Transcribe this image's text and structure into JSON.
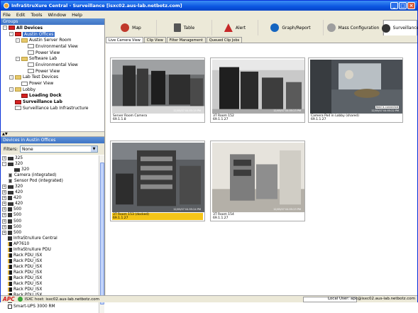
{
  "window": {
    "title": "InfraStruXure Central - Surveillance [isxc02.aus-lab.netbotz.com]",
    "controls": [
      "_",
      "□",
      "×"
    ]
  },
  "menu": [
    "File",
    "Edit",
    "Tools",
    "Window",
    "Help"
  ],
  "groups": {
    "header": "Groups",
    "tree": [
      {
        "label": "All Devices",
        "level": 0,
        "exp": "-",
        "icon": "red",
        "bold": true
      },
      {
        "label": "Austin Offices",
        "level": 1,
        "exp": "-",
        "icon": "red",
        "selected": true
      },
      {
        "label": "Austin Server Room",
        "level": 2,
        "exp": "-",
        "icon": "folder"
      },
      {
        "label": "Environmental View",
        "level": 3,
        "icon": "plain"
      },
      {
        "label": "Power View",
        "level": 3,
        "icon": "plain"
      },
      {
        "label": "Software Lab",
        "level": 2,
        "exp": "-",
        "icon": "folder"
      },
      {
        "label": "Environmental View",
        "level": 3,
        "icon": "plain"
      },
      {
        "label": "Power View",
        "level": 3,
        "icon": "plain"
      },
      {
        "label": "Lab Test Devices",
        "level": 1,
        "exp": "-",
        "icon": "folder"
      },
      {
        "label": "Power View",
        "level": 2,
        "icon": "plain"
      },
      {
        "label": "Lobby",
        "level": 1,
        "exp": "-",
        "icon": "folder"
      },
      {
        "label": "Loading Dock",
        "level": 2,
        "icon": "red",
        "bold": true
      },
      {
        "label": "Surveillance Lab",
        "level": 1,
        "icon": "red",
        "bold": true
      },
      {
        "label": "Surveillance Lab Infrastructure",
        "level": 1,
        "icon": "plain"
      }
    ]
  },
  "devices": {
    "header": "Devices in Austin Offices",
    "filter_label": "Filters:",
    "filter_value": "None",
    "items": [
      {
        "label": "325",
        "level": 0,
        "exp": "+",
        "icon": "dev"
      },
      {
        "label": "320",
        "level": 0,
        "exp": "-",
        "icon": "dev"
      },
      {
        "label": "320",
        "level": 1,
        "icon": "dev"
      },
      {
        "label": "Camera (integrated)",
        "level": 1,
        "icon": "cam"
      },
      {
        "label": "Sensor Pod (integrated)",
        "level": 1,
        "icon": "cam"
      },
      {
        "label": "320",
        "level": 0,
        "exp": "+",
        "icon": "dev"
      },
      {
        "label": "420",
        "level": 0,
        "exp": "+",
        "icon": "dev"
      },
      {
        "label": "420",
        "level": 0,
        "exp": "+",
        "icon": "box"
      },
      {
        "label": "420",
        "level": 0,
        "exp": "+",
        "icon": "dev"
      },
      {
        "label": "500",
        "level": 0,
        "exp": "+",
        "icon": "box"
      },
      {
        "label": "500",
        "level": 0,
        "exp": "+",
        "icon": "box"
      },
      {
        "label": "500",
        "level": 0,
        "exp": "+",
        "icon": "box"
      },
      {
        "label": "500",
        "level": 0,
        "exp": "+",
        "icon": "box"
      },
      {
        "label": "500",
        "level": 0,
        "exp": "+",
        "icon": "box"
      },
      {
        "label": "InfraStruXure Central",
        "level": 0,
        "icon": "box"
      },
      {
        "label": "AP7610",
        "level": 0,
        "icon": "pdu"
      },
      {
        "label": "InfraStruXure PDU",
        "level": 0,
        "icon": "pdu"
      },
      {
        "label": "Rack PDU_ISX",
        "level": 0,
        "icon": "pdu"
      },
      {
        "label": "Rack PDU_ISX",
        "level": 0,
        "icon": "pdu"
      },
      {
        "label": "Rack PDU_ISX",
        "level": 0,
        "icon": "pdu"
      },
      {
        "label": "Rack PDU_ISX",
        "level": 0,
        "icon": "pdu"
      },
      {
        "label": "Rack PDU_ISX",
        "level": 0,
        "icon": "pdu"
      },
      {
        "label": "Rack PDU_ISX",
        "level": 0,
        "icon": "pdu"
      },
      {
        "label": "Rack PDU_ISX",
        "level": 0,
        "icon": "pdu"
      },
      {
        "label": "Rack PDU_ISX",
        "level": 0,
        "icon": "pdu"
      },
      {
        "label": "Smart-UPS 3000",
        "level": 0,
        "icon": "ups"
      },
      {
        "label": "Smart-UPS 3000 RM",
        "level": 0,
        "icon": "ups"
      }
    ]
  },
  "toolbar": [
    {
      "label": "Map",
      "icon": "map-icon",
      "color": "#c0392b"
    },
    {
      "label": "Table",
      "icon": "table-icon",
      "color": "#555555"
    },
    {
      "label": "Alert",
      "icon": "alert-icon",
      "color": "#c62828"
    },
    {
      "label": "Graph/Report",
      "icon": "graph-icon",
      "color": "#1565c0"
    },
    {
      "label": "Mass Configuration",
      "icon": "config-icon",
      "color": "#9e9e9e"
    },
    {
      "label": "Surveillance",
      "icon": "camera-icon",
      "color": "#333333",
      "active": true
    }
  ],
  "tabs": [
    {
      "label": "Live Camera View",
      "active": true
    },
    {
      "label": "Clip View"
    },
    {
      "label": "Filter Management"
    },
    {
      "label": "Queued Clip Jobs"
    }
  ],
  "cameras": [
    {
      "name": "Server Room Camera",
      "ip": "69.1.1.8",
      "timestamp": "12/05/07 04:55:19 PM",
      "scene": "server",
      "selected": false
    },
    {
      "name": "3T Room 152",
      "ip": "69.1.1.27",
      "timestamp": "12/05/07 04:55:23 PM",
      "scene": "rack",
      "selected": false
    },
    {
      "name": "Camera Pod in Lobby (shared)",
      "ip": "69.1.1.27",
      "timestamp": "12/05/07 04:55:22 PM",
      "scene": "lobby",
      "selected": false,
      "badge": "feed is connected"
    },
    {
      "name": "3T Room 153 (docked)",
      "ip": "69.1.1.27",
      "timestamp": "12/05/07 04:55:24 PM",
      "scene": "equipment",
      "selected": true
    },
    {
      "name": "3T Room 154",
      "ip": "69.1.1.27",
      "timestamp": "12/05/07 04:55:23 PM",
      "scene": "room",
      "selected": false
    }
  ],
  "status": {
    "host": "ISXC host: isxc02.aus-lab.netbotz.com",
    "user": "Local User: apc@isxc02.aus-lab.netbotz.com",
    "brand": "APC"
  }
}
